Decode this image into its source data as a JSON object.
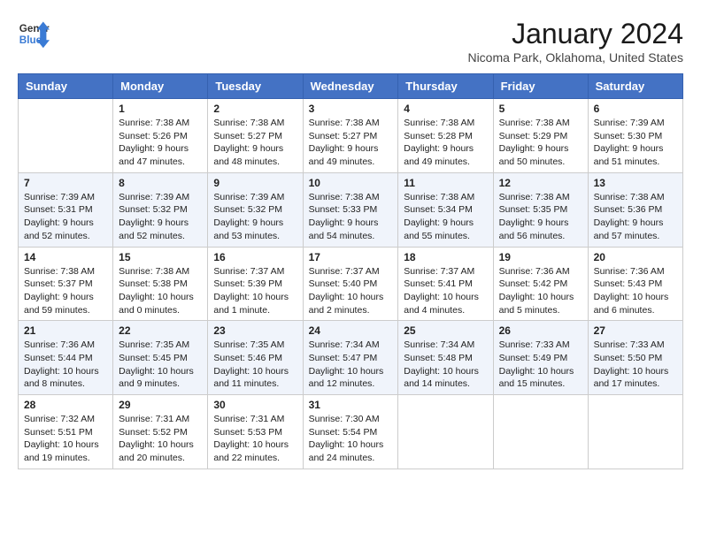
{
  "header": {
    "logo_general": "General",
    "logo_blue": "Blue",
    "month": "January 2024",
    "location": "Nicoma Park, Oklahoma, United States"
  },
  "weekdays": [
    "Sunday",
    "Monday",
    "Tuesday",
    "Wednesday",
    "Thursday",
    "Friday",
    "Saturday"
  ],
  "weeks": [
    [
      {
        "day": "",
        "sunrise": "",
        "sunset": "",
        "daylight": ""
      },
      {
        "day": "1",
        "sunrise": "Sunrise: 7:38 AM",
        "sunset": "Sunset: 5:26 PM",
        "daylight": "Daylight: 9 hours and 47 minutes."
      },
      {
        "day": "2",
        "sunrise": "Sunrise: 7:38 AM",
        "sunset": "Sunset: 5:27 PM",
        "daylight": "Daylight: 9 hours and 48 minutes."
      },
      {
        "day": "3",
        "sunrise": "Sunrise: 7:38 AM",
        "sunset": "Sunset: 5:27 PM",
        "daylight": "Daylight: 9 hours and 49 minutes."
      },
      {
        "day": "4",
        "sunrise": "Sunrise: 7:38 AM",
        "sunset": "Sunset: 5:28 PM",
        "daylight": "Daylight: 9 hours and 49 minutes."
      },
      {
        "day": "5",
        "sunrise": "Sunrise: 7:38 AM",
        "sunset": "Sunset: 5:29 PM",
        "daylight": "Daylight: 9 hours and 50 minutes."
      },
      {
        "day": "6",
        "sunrise": "Sunrise: 7:39 AM",
        "sunset": "Sunset: 5:30 PM",
        "daylight": "Daylight: 9 hours and 51 minutes."
      }
    ],
    [
      {
        "day": "7",
        "sunrise": "Sunrise: 7:39 AM",
        "sunset": "Sunset: 5:31 PM",
        "daylight": "Daylight: 9 hours and 52 minutes."
      },
      {
        "day": "8",
        "sunrise": "Sunrise: 7:39 AM",
        "sunset": "Sunset: 5:32 PM",
        "daylight": "Daylight: 9 hours and 52 minutes."
      },
      {
        "day": "9",
        "sunrise": "Sunrise: 7:39 AM",
        "sunset": "Sunset: 5:32 PM",
        "daylight": "Daylight: 9 hours and 53 minutes."
      },
      {
        "day": "10",
        "sunrise": "Sunrise: 7:38 AM",
        "sunset": "Sunset: 5:33 PM",
        "daylight": "Daylight: 9 hours and 54 minutes."
      },
      {
        "day": "11",
        "sunrise": "Sunrise: 7:38 AM",
        "sunset": "Sunset: 5:34 PM",
        "daylight": "Daylight: 9 hours and 55 minutes."
      },
      {
        "day": "12",
        "sunrise": "Sunrise: 7:38 AM",
        "sunset": "Sunset: 5:35 PM",
        "daylight": "Daylight: 9 hours and 56 minutes."
      },
      {
        "day": "13",
        "sunrise": "Sunrise: 7:38 AM",
        "sunset": "Sunset: 5:36 PM",
        "daylight": "Daylight: 9 hours and 57 minutes."
      }
    ],
    [
      {
        "day": "14",
        "sunrise": "Sunrise: 7:38 AM",
        "sunset": "Sunset: 5:37 PM",
        "daylight": "Daylight: 9 hours and 59 minutes."
      },
      {
        "day": "15",
        "sunrise": "Sunrise: 7:38 AM",
        "sunset": "Sunset: 5:38 PM",
        "daylight": "Daylight: 10 hours and 0 minutes."
      },
      {
        "day": "16",
        "sunrise": "Sunrise: 7:37 AM",
        "sunset": "Sunset: 5:39 PM",
        "daylight": "Daylight: 10 hours and 1 minute."
      },
      {
        "day": "17",
        "sunrise": "Sunrise: 7:37 AM",
        "sunset": "Sunset: 5:40 PM",
        "daylight": "Daylight: 10 hours and 2 minutes."
      },
      {
        "day": "18",
        "sunrise": "Sunrise: 7:37 AM",
        "sunset": "Sunset: 5:41 PM",
        "daylight": "Daylight: 10 hours and 4 minutes."
      },
      {
        "day": "19",
        "sunrise": "Sunrise: 7:36 AM",
        "sunset": "Sunset: 5:42 PM",
        "daylight": "Daylight: 10 hours and 5 minutes."
      },
      {
        "day": "20",
        "sunrise": "Sunrise: 7:36 AM",
        "sunset": "Sunset: 5:43 PM",
        "daylight": "Daylight: 10 hours and 6 minutes."
      }
    ],
    [
      {
        "day": "21",
        "sunrise": "Sunrise: 7:36 AM",
        "sunset": "Sunset: 5:44 PM",
        "daylight": "Daylight: 10 hours and 8 minutes."
      },
      {
        "day": "22",
        "sunrise": "Sunrise: 7:35 AM",
        "sunset": "Sunset: 5:45 PM",
        "daylight": "Daylight: 10 hours and 9 minutes."
      },
      {
        "day": "23",
        "sunrise": "Sunrise: 7:35 AM",
        "sunset": "Sunset: 5:46 PM",
        "daylight": "Daylight: 10 hours and 11 minutes."
      },
      {
        "day": "24",
        "sunrise": "Sunrise: 7:34 AM",
        "sunset": "Sunset: 5:47 PM",
        "daylight": "Daylight: 10 hours and 12 minutes."
      },
      {
        "day": "25",
        "sunrise": "Sunrise: 7:34 AM",
        "sunset": "Sunset: 5:48 PM",
        "daylight": "Daylight: 10 hours and 14 minutes."
      },
      {
        "day": "26",
        "sunrise": "Sunrise: 7:33 AM",
        "sunset": "Sunset: 5:49 PM",
        "daylight": "Daylight: 10 hours and 15 minutes."
      },
      {
        "day": "27",
        "sunrise": "Sunrise: 7:33 AM",
        "sunset": "Sunset: 5:50 PM",
        "daylight": "Daylight: 10 hours and 17 minutes."
      }
    ],
    [
      {
        "day": "28",
        "sunrise": "Sunrise: 7:32 AM",
        "sunset": "Sunset: 5:51 PM",
        "daylight": "Daylight: 10 hours and 19 minutes."
      },
      {
        "day": "29",
        "sunrise": "Sunrise: 7:31 AM",
        "sunset": "Sunset: 5:52 PM",
        "daylight": "Daylight: 10 hours and 20 minutes."
      },
      {
        "day": "30",
        "sunrise": "Sunrise: 7:31 AM",
        "sunset": "Sunset: 5:53 PM",
        "daylight": "Daylight: 10 hours and 22 minutes."
      },
      {
        "day": "31",
        "sunrise": "Sunrise: 7:30 AM",
        "sunset": "Sunset: 5:54 PM",
        "daylight": "Daylight: 10 hours and 24 minutes."
      },
      {
        "day": "",
        "sunrise": "",
        "sunset": "",
        "daylight": ""
      },
      {
        "day": "",
        "sunrise": "",
        "sunset": "",
        "daylight": ""
      },
      {
        "day": "",
        "sunrise": "",
        "sunset": "",
        "daylight": ""
      }
    ]
  ]
}
